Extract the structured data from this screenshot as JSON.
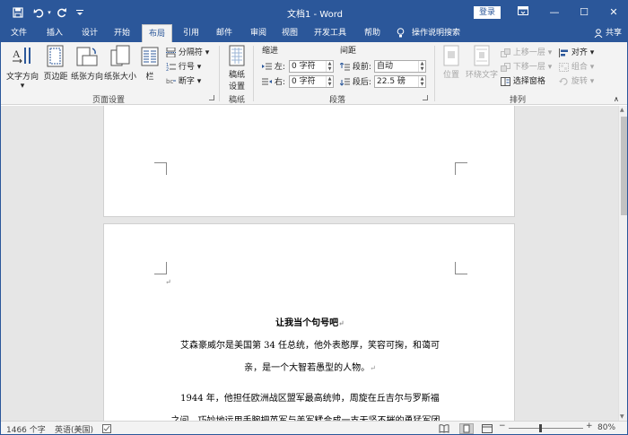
{
  "titlebar": {
    "doc_title": "文档1 - Word",
    "login_label": "登录",
    "minimize": "—",
    "restore": "☐",
    "close": "✕",
    "ribbon_display_icon": "ribbon-display-icon"
  },
  "qat": {
    "save_icon": "save-icon",
    "undo_icon": "undo-icon",
    "redo_icon": "redo-icon",
    "customize_icon": "chevron-down-icon"
  },
  "tabs": [
    "文件",
    "插入",
    "设计",
    "开始",
    "布局",
    "引用",
    "邮件",
    "审阅",
    "视图",
    "开发工具",
    "帮助"
  ],
  "active_tab": "布局",
  "tellme": "操作说明搜索",
  "share": "共享",
  "ribbon": {
    "page_setup": {
      "text_direction": "文字方向",
      "margins": "页边距",
      "orientation": "纸张方向",
      "size": "纸张大小",
      "columns": "栏",
      "breaks": "分隔符",
      "line_numbers": "行号",
      "hyphenation": "断字",
      "label": "页面设置"
    },
    "manuscript": {
      "settings_line1": "稿纸",
      "settings_line2": "设置",
      "label": "稿纸"
    },
    "paragraph": {
      "indent_label": "缩进",
      "spacing_label": "间距",
      "left_label": "左:",
      "left_value": "0 字符",
      "right_label": "右:",
      "right_value": "0 字符",
      "before_label": "段前:",
      "before_value": "自动",
      "after_label": "段后:",
      "after_value": "22.5 磅",
      "label": "段落"
    },
    "arrange": {
      "position": "位置",
      "wrap_text": "环绕文字",
      "bring_forward": "上移一层",
      "send_backward": "下移一层",
      "selection_pane": "选择窗格",
      "align": "对齐",
      "group": "组合",
      "rotate": "旋转",
      "label": "排列"
    }
  },
  "document": {
    "return_mark": "↵",
    "heading": "让我当个句号吧",
    "p1_line1": "艾森豪威尔是美国第 34 任总统，他外表憨厚，笑容可掬，和蔼可",
    "p1_line2": "亲，是一个大智若愚型的人物。",
    "p2_line1": "1944 年，他担任欧洲战区盟军最高统帅，周旋在丘吉尔与罗斯福",
    "p2_line2": "之间，巧妙地运用手腕把英军与美军糅合成一支无坚不摧的勇猛军团。"
  },
  "status": {
    "word_count": "1466 个字",
    "language": "英语(美国)",
    "zoom": "80%",
    "zoom_out": "−",
    "zoom_in": "+"
  },
  "colors": {
    "brand": "#2b579a",
    "ribbon_bg": "#f3f3f3",
    "doc_bg": "#e6e6e6"
  }
}
